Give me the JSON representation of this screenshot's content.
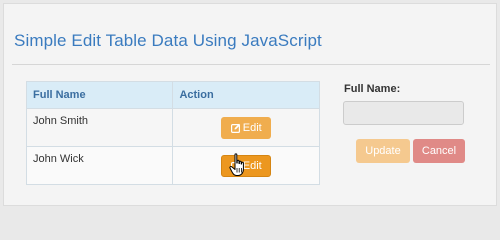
{
  "page": {
    "title": "Simple Edit Table Data Using JavaScript"
  },
  "table": {
    "headers": {
      "name": "Full Name",
      "action": "Action"
    },
    "rows": [
      {
        "name": "John Smith",
        "action_label": "Edit"
      },
      {
        "name": "John Wick",
        "action_label": "Edit"
      }
    ]
  },
  "form": {
    "label": "Full Name:",
    "value": "",
    "update_label": "Update",
    "cancel_label": "Cancel"
  },
  "colors": {
    "title": "#3a7bbf",
    "header_bg": "#d9ecf7",
    "edit_button": "#f0ad4e",
    "update_button": "#f5c98f",
    "cancel_button": "#e08a87"
  },
  "icons": {
    "edit": "edit-square-icon",
    "cursor": "hand-pointer-icon"
  }
}
